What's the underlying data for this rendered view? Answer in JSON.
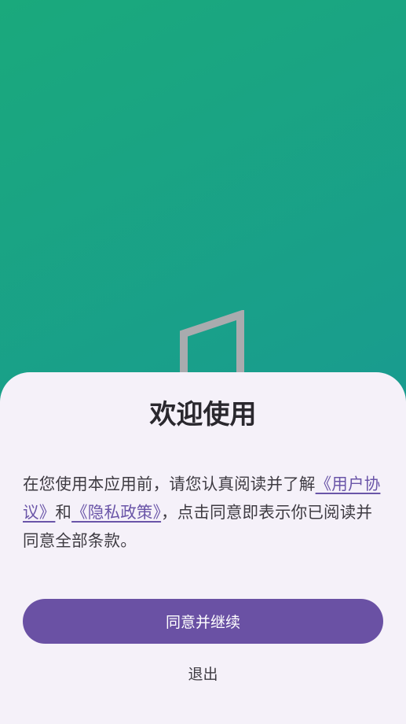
{
  "dialog": {
    "title": "欢迎使用",
    "text_before": "在您使用本应用前，请您认真阅读并了解",
    "user_agreement_link": "《用户协议》",
    "text_and": "和",
    "privacy_policy_link": "《隐私政策》",
    "text_after": "，点击同意即表示你已阅读并同意全部条款。",
    "agree_button": "同意并继续",
    "exit_button": "退出"
  },
  "colors": {
    "background_gradient_start": "#1aa97c",
    "background_gradient_end": "#178f9c",
    "sheet_background": "#f5f1f9",
    "primary_button": "#6a51a4",
    "link": "#6a55a8"
  },
  "icons": {
    "app_logo": "door-logo-icon"
  }
}
